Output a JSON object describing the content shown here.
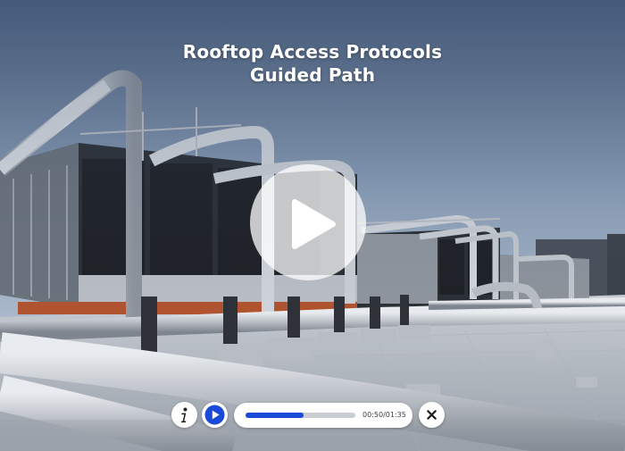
{
  "video": {
    "title_line1": "Rooftop Access Protocols",
    "title_line2": "Guided Path",
    "big_play_icon": "play-icon"
  },
  "controls": {
    "info_icon": "info-icon",
    "play_icon": "play-icon",
    "close_icon": "close-icon",
    "current_time": "00:50",
    "separator": "/",
    "duration": "01:35",
    "progress_fraction": 0.526
  },
  "colors": {
    "accent": "#1a4ad6",
    "button_bg": "#ffffff",
    "track": "#c9ccd3"
  }
}
